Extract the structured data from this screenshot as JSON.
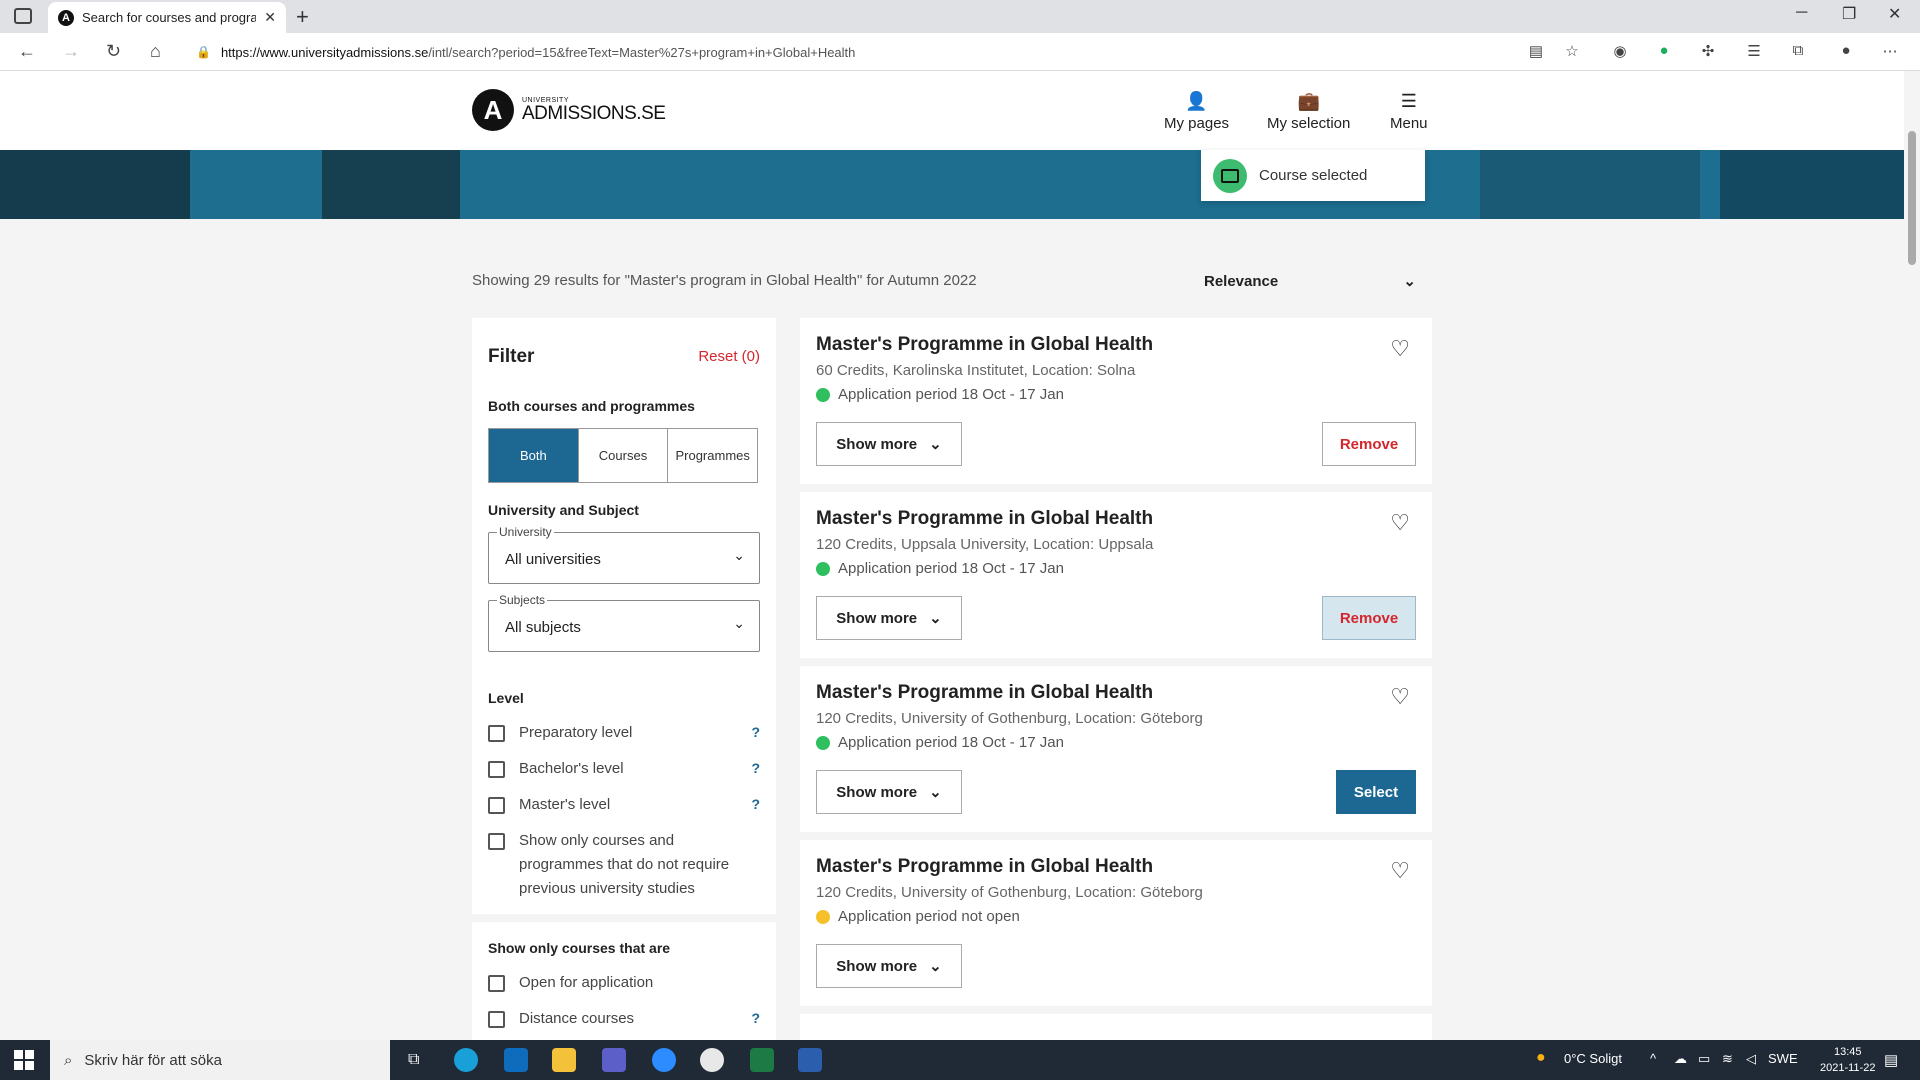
{
  "browser": {
    "tab_title": "Search for courses and programmes",
    "url_domain": "https://www.universityadmissions.se",
    "url_path": "/intl/search?period=15&freeText=Master%27s+program+in+Global+Health"
  },
  "site": {
    "logo_small": "UNIVERSITY",
    "logo_big": "ADMISSIONS.SE",
    "nav": [
      {
        "label": "My pages",
        "icon": "user-icon"
      },
      {
        "label": "My selection",
        "icon": "bag-icon"
      },
      {
        "label": "Menu",
        "icon": "hamburger-icon"
      }
    ],
    "toast": "Course selected"
  },
  "results": {
    "summary": "Showing 29 results for \"Master's program in Global Health\" for Autumn 2022",
    "sort_value": "Relevance"
  },
  "filter": {
    "title": "Filter",
    "reset": "Reset (0)",
    "type_heading": "Both courses and programmes",
    "type_options": [
      "Both",
      "Courses",
      "Programmes"
    ],
    "uni_heading": "University and Subject",
    "university_label": "University",
    "university_value": "All universities",
    "subjects_label": "Subjects",
    "subjects_value": "All subjects",
    "level_heading": "Level",
    "levels": [
      "Preparatory level",
      "Bachelor's level",
      "Master's level"
    ],
    "no_prev": "Show only courses and programmes that do not require previous university studies",
    "only_heading": "Show only courses that are",
    "only": [
      "Open for application",
      "Distance courses"
    ],
    "help": "?"
  },
  "cards": [
    {
      "title": "Master's Programme in Global Health",
      "meta": "60 Credits, Karolinska Institutet, Location: Solna",
      "status": "Application period 18 Oct - 17 Jan",
      "status_color": "#2fbf5f",
      "more": "Show more",
      "action": "Remove"
    },
    {
      "title": "Master's Programme in Global Health",
      "meta": "120 Credits, Uppsala University, Location: Uppsala",
      "status": "Application period 18 Oct - 17 Jan",
      "status_color": "#2fbf5f",
      "more": "Show more",
      "action": "Remove"
    },
    {
      "title": "Master's Programme in Global Health",
      "meta": "120 Credits, University of Gothenburg, Location: Göteborg",
      "status": "Application period 18 Oct - 17 Jan",
      "status_color": "#2fbf5f",
      "more": "Show more",
      "action": "Select"
    },
    {
      "title": "Master's Programme in Global Health",
      "meta": "120 Credits, University of Gothenburg, Location: Göteborg",
      "status": "Application period not open",
      "status_color": "#f5c02a",
      "more": "Show more",
      "action": ""
    }
  ],
  "taskbar": {
    "search_placeholder": "Skriv här för att söka",
    "weather": "0°C  Soligt",
    "lang": "SWE",
    "time": "13:45",
    "date": "2021-11-22"
  },
  "colors": {
    "brand": "#1d6892",
    "danger": "#d4262d",
    "success": "#3dbb6e"
  }
}
